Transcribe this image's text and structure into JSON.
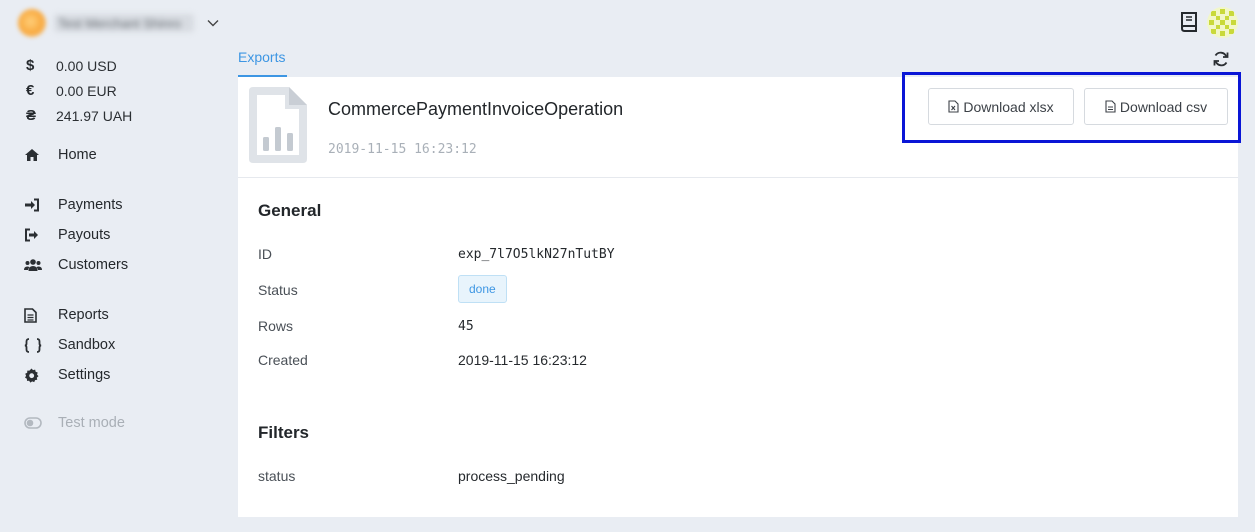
{
  "merchant": {
    "name": "Test Merchant Shinro"
  },
  "balances": [
    {
      "symbol": "$",
      "amount": "0.00 USD"
    },
    {
      "symbol": "€",
      "amount": "0.00 EUR"
    },
    {
      "symbol": "₴",
      "amount": "241.97 UAH"
    }
  ],
  "nav": {
    "home": "Home",
    "payments": "Payments",
    "payouts": "Payouts",
    "customers": "Customers",
    "reports": "Reports",
    "sandbox": "Sandbox",
    "settings": "Settings",
    "test_mode": "Test mode"
  },
  "tabs": {
    "exports": "Exports"
  },
  "export": {
    "title": "CommercePaymentInvoiceOperation",
    "timestamp": "2019-11-15 16:23:12",
    "download_xlsx": "Download xlsx",
    "download_csv": "Download csv"
  },
  "general": {
    "title": "General",
    "id_label": "ID",
    "id_value": "exp_7l7O5lkN27nTutBY",
    "status_label": "Status",
    "status_value": "done",
    "rows_label": "Rows",
    "rows_value": "45",
    "created_label": "Created",
    "created_value": "2019-11-15 16:23:12"
  },
  "filters": {
    "title": "Filters",
    "key": "status",
    "value": "process_pending"
  },
  "colors": {
    "accent": "#3d96e3",
    "highlight_box": "#0a16d6",
    "background": "#e9edf3"
  }
}
